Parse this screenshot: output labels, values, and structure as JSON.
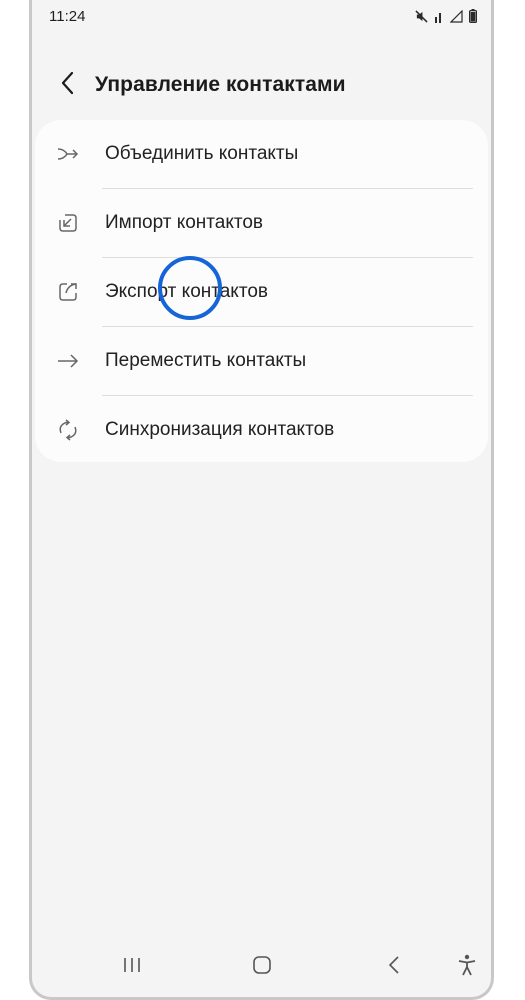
{
  "status_bar": {
    "time": "11:24",
    "icons": [
      "mute-icon",
      "wifi-calling-icon",
      "signal-icon",
      "battery-icon"
    ]
  },
  "header": {
    "back_icon": "chevron-left-icon",
    "title": "Управление контактами"
  },
  "menu": {
    "items": [
      {
        "label": "Объединить контакты",
        "icon": "merge-icon"
      },
      {
        "label": "Импорт контактов",
        "icon": "import-icon"
      },
      {
        "label": "Экспорт контактов",
        "icon": "export-icon"
      },
      {
        "label": "Переместить контакты",
        "icon": "move-arrow-icon"
      },
      {
        "label": "Синхронизация контактов",
        "icon": "sync-icon"
      }
    ]
  },
  "highlight": {
    "target": "Экспорт контактов",
    "color": "#1565d8"
  },
  "nav_bar": {
    "buttons": [
      "recent-apps-icon",
      "home-icon",
      "back-icon",
      "accessibility-icon"
    ]
  },
  "colors": {
    "background": "#f4f4f4",
    "card": "#fcfcfc",
    "text": "#222222",
    "icon": "#666666"
  }
}
